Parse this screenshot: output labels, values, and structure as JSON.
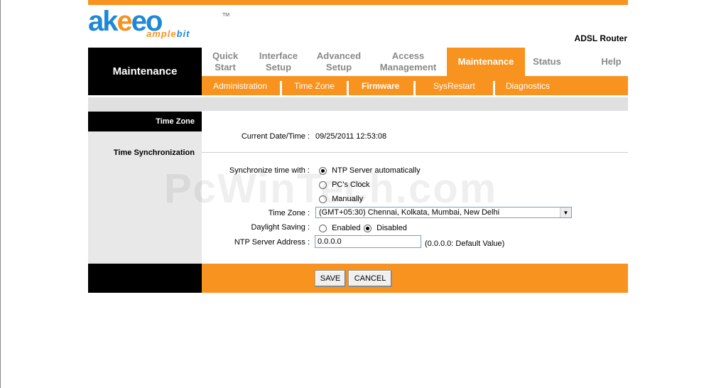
{
  "brand": {
    "logo_main_1": "ak",
    "logo_main_2": "e",
    "logo_main_3": "e",
    "logo_main_4": "o",
    "tm": "TM",
    "sub_1": "ample",
    "sub_2": "bit"
  },
  "model": "ADSL Router",
  "section_title": "Maintenance",
  "nav": [
    {
      "line1": "Quick",
      "line2": "Start"
    },
    {
      "line1": "Interface",
      "line2": "Setup"
    },
    {
      "line1": "Advanced",
      "line2": "Setup"
    },
    {
      "line1": "Access",
      "line2": "Management"
    },
    {
      "line1": "Maintenance",
      "line2": ""
    },
    {
      "line1": "Status",
      "line2": ""
    },
    {
      "line1": "Help",
      "line2": ""
    }
  ],
  "subnav": [
    "Administration",
    "Time Zone",
    "Firmware",
    "SysRestart",
    "Diagnostics"
  ],
  "left": {
    "time_zone": "Time Zone",
    "time_sync": "Time Synchronization"
  },
  "form": {
    "current_datetime_label": "Current Date/Time :",
    "current_datetime_value": "09/25/2011 12:53:08",
    "sync_label": "Synchronize time with :",
    "sync_options": [
      "NTP Server automatically",
      "PC's Clock",
      "Manually"
    ],
    "tz_label": "Time Zone :",
    "tz_value": "(GMT+05:30) Chennai, Kolkata, Mumbai, New Delhi",
    "dst_label": "Daylight Saving :",
    "dst_options": [
      "Enabled",
      "Disabled"
    ],
    "ntp_label": "NTP Server Address :",
    "ntp_value": "0.0.0.0",
    "ntp_hint": "(0.0.0.0: Default Value)"
  },
  "buttons": {
    "save": "SAVE",
    "cancel": "CANCEL"
  },
  "watermark": "PcWinTech.com",
  "colors": {
    "accent": "#f7931e",
    "brand_blue": "#1e88d6"
  }
}
